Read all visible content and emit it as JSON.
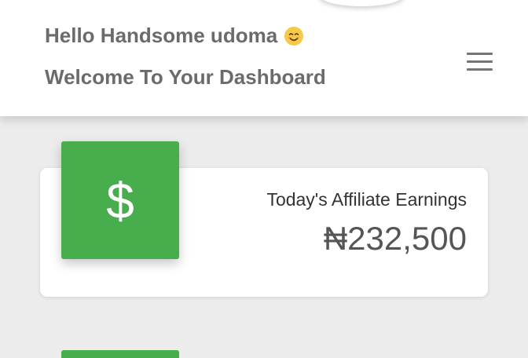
{
  "header": {
    "greeting": "Hello Handsome udoma",
    "greeting_emoji": "smiling-face-icon",
    "welcome": "Welcome To Your Dashboard",
    "menu_icon": "hamburger-menu-icon"
  },
  "earnings_card": {
    "icon": "dollar-sign-icon",
    "icon_glyph": "$",
    "title": "Today's Affiliate Earnings",
    "value": "₦232,500"
  },
  "colors": {
    "accent_green": "#48ad4d",
    "header_text": "#6b6b6b",
    "background": "#ececec"
  }
}
